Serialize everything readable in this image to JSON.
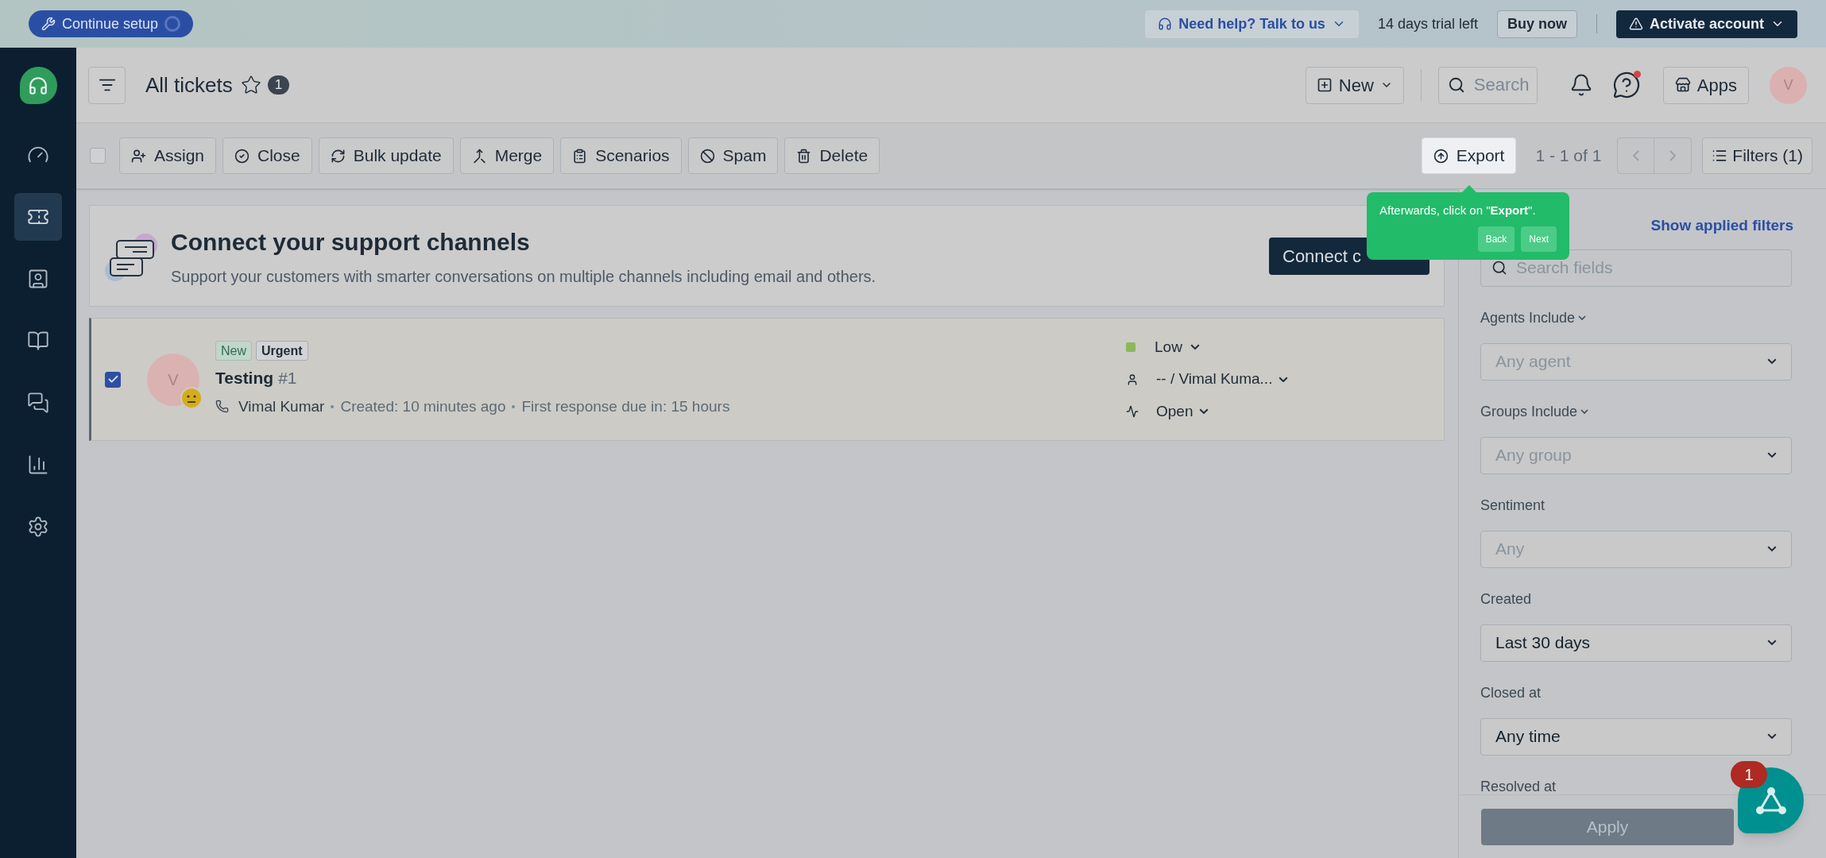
{
  "top_bar": {
    "setup_button": "Continue setup",
    "help_button": "Need help? Talk to us",
    "trial_text": "14 days trial left",
    "buy_button": "Buy now",
    "activate_button": "Activate account"
  },
  "sidebar": {
    "items": [
      {
        "kind": "dashboard",
        "selected": false
      },
      {
        "kind": "tickets",
        "selected": true
      },
      {
        "kind": "contacts",
        "selected": false
      },
      {
        "kind": "knowledge",
        "selected": false
      },
      {
        "kind": "conversations",
        "selected": false
      },
      {
        "kind": "reports",
        "selected": false
      },
      {
        "kind": "settings",
        "selected": false
      }
    ]
  },
  "header": {
    "title": "All tickets",
    "count": "1",
    "new_button": "New",
    "search": {
      "placeholder": "Search"
    },
    "apps_button": "Apps",
    "avatar": "V"
  },
  "toolbar": {
    "select_all_checked": false,
    "actions": [
      {
        "kind": "assign",
        "label": "Assign"
      },
      {
        "kind": "close",
        "label": "Close"
      },
      {
        "kind": "bulk",
        "label": "Bulk update"
      },
      {
        "kind": "merge",
        "label": "Merge"
      },
      {
        "kind": "scenarios",
        "label": "Scenarios"
      },
      {
        "kind": "spam",
        "label": "Spam"
      },
      {
        "kind": "delete",
        "label": "Delete"
      }
    ],
    "export_button": "Export",
    "pagination": "1 - 1 of 1",
    "filters_button": "Filters (1)"
  },
  "tooltip": {
    "text": "Afterwards, click on \"**Export**\".",
    "buttons": [
      "Back",
      "Next"
    ]
  },
  "banner": {
    "title": "Connect your support channels",
    "subtitle": "Support your customers with smarter conversations on multiple channels including email and others.",
    "button": "Connect c"
  },
  "tickets": [
    {
      "checked": true,
      "avatar": "V",
      "tags": [
        {
          "kind": "new",
          "label": "New"
        },
        {
          "kind": "urgent",
          "label": "Urgent"
        }
      ],
      "subject": "Testing",
      "number": "#1",
      "requester": "Vimal Kumar",
      "created": "Created: 10 minutes ago",
      "due": "First response due in: 15 hours",
      "priority": {
        "label": "Low",
        "color": "#8cb85c"
      },
      "assignee": "-- / Vimal Kuma...",
      "status": "Open"
    }
  ],
  "filters": {
    "link": "Show applied filters",
    "search": {
      "placeholder": "Search fields"
    },
    "fields": [
      {
        "label": "Agents Include",
        "has_menu": true,
        "placeholder": "Any agent"
      },
      {
        "label": "Groups Include",
        "has_menu": true,
        "placeholder": "Any group"
      },
      {
        "label": "Sentiment",
        "has_menu": false,
        "placeholder": "Any"
      },
      {
        "label": "Created",
        "has_menu": false,
        "value": "Last 30 days"
      },
      {
        "label": "Closed at",
        "has_menu": false,
        "value": "Any time"
      },
      {
        "label": "Resolved at",
        "has_menu": false
      }
    ],
    "apply_button": "Apply"
  },
  "chat_widget": {
    "badge": "1"
  }
}
